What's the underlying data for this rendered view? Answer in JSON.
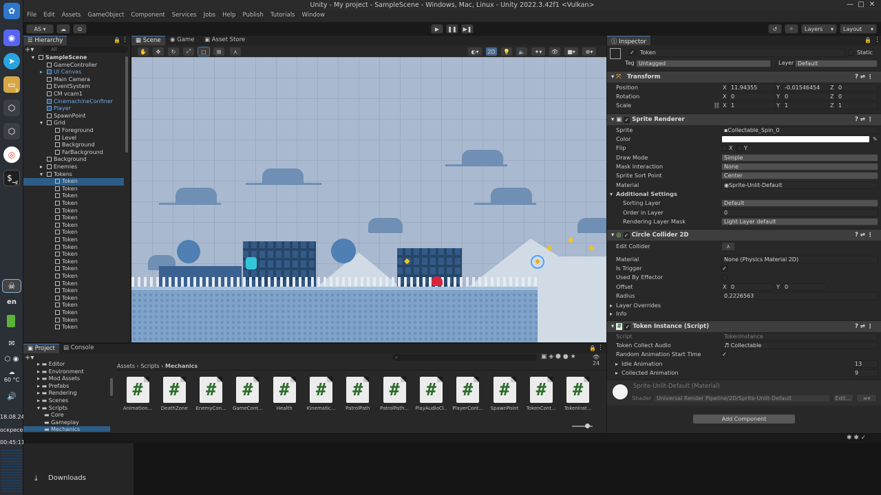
{
  "dock": {
    "date": "18.08.24",
    "day": "оскресен",
    "time": "00:45:11",
    "temperature": "60 °C",
    "lang": "en",
    "icons": [
      "ubuntu-icon",
      "discord-icon",
      "telegram-icon",
      "files-icon",
      "unity-hub-icon",
      "unity-icon",
      "chrome-icon",
      "terminal-icon"
    ],
    "badge_files": "3",
    "badge_terminal": "2"
  },
  "window": {
    "title": "Unity - My project - SampleScene - Windows, Mac, Linux - Unity 2022.3.42f1 <Vulkan>"
  },
  "menu": [
    "File",
    "Edit",
    "Assets",
    "GameObject",
    "Component",
    "Services",
    "Jobs",
    "Help",
    "Publish",
    "Tutorials",
    "Window"
  ],
  "toolbar": {
    "account": "AS",
    "layers": "Layers",
    "layout": "Layout"
  },
  "hierarchy": {
    "tab": "Hierarchy",
    "search_placeholder": "All",
    "items": [
      {
        "label": "SampleScene",
        "indent": 0,
        "bold": true,
        "type": "scene"
      },
      {
        "label": "GameController",
        "indent": 1
      },
      {
        "label": "UI Canvas",
        "indent": 1,
        "prefab": true
      },
      {
        "label": "Main Camera",
        "indent": 1
      },
      {
        "label": "EventSystem",
        "indent": 1
      },
      {
        "label": "CM vcam1",
        "indent": 1
      },
      {
        "label": "CinemachineConfiner",
        "indent": 1,
        "prefab": true
      },
      {
        "label": "Player",
        "indent": 1,
        "prefab": true
      },
      {
        "label": "SpawnPoint",
        "indent": 1
      },
      {
        "label": "Grid",
        "indent": 1
      },
      {
        "label": "Foreground",
        "indent": 2
      },
      {
        "label": "Level",
        "indent": 2
      },
      {
        "label": "Background",
        "indent": 2
      },
      {
        "label": "FarBackground",
        "indent": 2
      },
      {
        "label": "Background",
        "indent": 1
      },
      {
        "label": "Enemies",
        "indent": 1
      },
      {
        "label": "Tokens",
        "indent": 1
      },
      {
        "label": "Token",
        "indent": 2,
        "selected": true
      },
      {
        "label": "Token",
        "indent": 2
      },
      {
        "label": "Token",
        "indent": 2
      },
      {
        "label": "Token",
        "indent": 2
      },
      {
        "label": "Token",
        "indent": 2
      },
      {
        "label": "Token",
        "indent": 2
      },
      {
        "label": "Token",
        "indent": 2
      },
      {
        "label": "Token",
        "indent": 2
      },
      {
        "label": "Token",
        "indent": 2
      },
      {
        "label": "Token",
        "indent": 2
      },
      {
        "label": "Token",
        "indent": 2
      },
      {
        "label": "Token",
        "indent": 2
      },
      {
        "label": "Token",
        "indent": 2
      },
      {
        "label": "Token",
        "indent": 2
      },
      {
        "label": "Token",
        "indent": 2
      },
      {
        "label": "Token",
        "indent": 2
      },
      {
        "label": "Token",
        "indent": 2
      },
      {
        "label": "Token",
        "indent": 2
      },
      {
        "label": "Token",
        "indent": 2
      },
      {
        "label": "Token",
        "indent": 2
      },
      {
        "label": "Token",
        "indent": 2
      }
    ]
  },
  "scene_tabs": [
    "Scene",
    "Game",
    "Asset Store"
  ],
  "scene_toggle_2d": "2D",
  "project": {
    "tabs": [
      "Project",
      "Console"
    ],
    "count": "24",
    "breadcrumb": [
      "Assets",
      "Scripts",
      "Mechanics"
    ],
    "folders": [
      {
        "label": "Editor",
        "indent": 1
      },
      {
        "label": "Environment",
        "indent": 1
      },
      {
        "label": "Mod Assets",
        "indent": 1
      },
      {
        "label": "Prefabs",
        "indent": 1
      },
      {
        "label": "Rendering",
        "indent": 1
      },
      {
        "label": "Scenes",
        "indent": 1
      },
      {
        "label": "Scripts",
        "indent": 1
      },
      {
        "label": "Core",
        "indent": 2
      },
      {
        "label": "Gameplay",
        "indent": 2
      },
      {
        "label": "Mechanics",
        "indent": 2,
        "selected": true
      }
    ],
    "files": [
      "Animation...",
      "DeathZone",
      "EnemyCon...",
      "GameCont...",
      "Health",
      "Kinematic...",
      "PatrolPath",
      "PatrolPath...",
      "PlayAudioCl...",
      "PlayerCont...",
      "SpawnPoint",
      "TokenCont...",
      "TokenInst..."
    ]
  },
  "inspector": {
    "tab": "Inspector",
    "name": "Token",
    "static_label": "Static",
    "tag_label": "Tag",
    "tag_value": "Untagged",
    "layer_label": "Layer",
    "layer_value": "Default",
    "transform": {
      "title": "Transform",
      "position_label": "Position",
      "position": [
        "11.94355",
        "-0.01546454",
        "0"
      ],
      "rotation_label": "Rotation",
      "rotation": [
        "0",
        "0",
        "0"
      ],
      "scale_label": "Scale",
      "scale": [
        "1",
        "1",
        "1"
      ]
    },
    "sprite_renderer": {
      "title": "Sprite Renderer",
      "sprite_label": "Sprite",
      "sprite": "Collectable_Spin_0",
      "color_label": "Color",
      "flip_label": "Flip",
      "flip_x": "X",
      "flip_y": "Y",
      "draw_mode_label": "Draw Mode",
      "draw_mode": "Simple",
      "mask_label": "Mask Interaction",
      "mask": "None",
      "sort_point_label": "Sprite Sort Point",
      "sort_point": "Center",
      "material_label": "Material",
      "material": "Sprite-Unlit-Default",
      "additional": "Additional Settings",
      "sorting_layer_label": "Sorting Layer",
      "sorting_layer": "Default",
      "order_label": "Order in Layer",
      "order": "0",
      "rlm_label": "Rendering Layer Mask",
      "rlm": "Light Layer default"
    },
    "collider": {
      "title": "Circle Collider 2D",
      "edit_label": "Edit Collider",
      "material_label": "Material",
      "material": "None (Physics Material 2D)",
      "trigger_label": "Is Trigger",
      "effector_label": "Used By Effector",
      "offset_label": "Offset",
      "offset": [
        "0",
        "0"
      ],
      "radius_label": "Radius",
      "radius": "0.2226563",
      "layer_overrides": "Layer Overrides",
      "info": "Info"
    },
    "script": {
      "title": "Token Instance (Script)",
      "script_label": "Script",
      "script": "TokenInstance",
      "audio_label": "Token Collect Audio",
      "audio": "Collectable",
      "random_label": "Random Animation Start Time",
      "idle_label": "Idle Animation",
      "idle": "13",
      "collected_label": "Collected Animation",
      "collected": "9"
    },
    "material": {
      "title": "Sprite-Unlit-Default (Material)",
      "shader_label": "Shader",
      "shader": "Universal Render Pipeline/2D/Sprite-Unlit-Default",
      "edit": "Edit..."
    },
    "add_component": "Add Component"
  },
  "taskbar": {
    "downloads": "Downloads"
  },
  "colors": {
    "accent": "#3a79bb",
    "selection": "#2c5d87",
    "prefab": "#6fa8e0",
    "scene_bg": "#a9bfd8"
  }
}
